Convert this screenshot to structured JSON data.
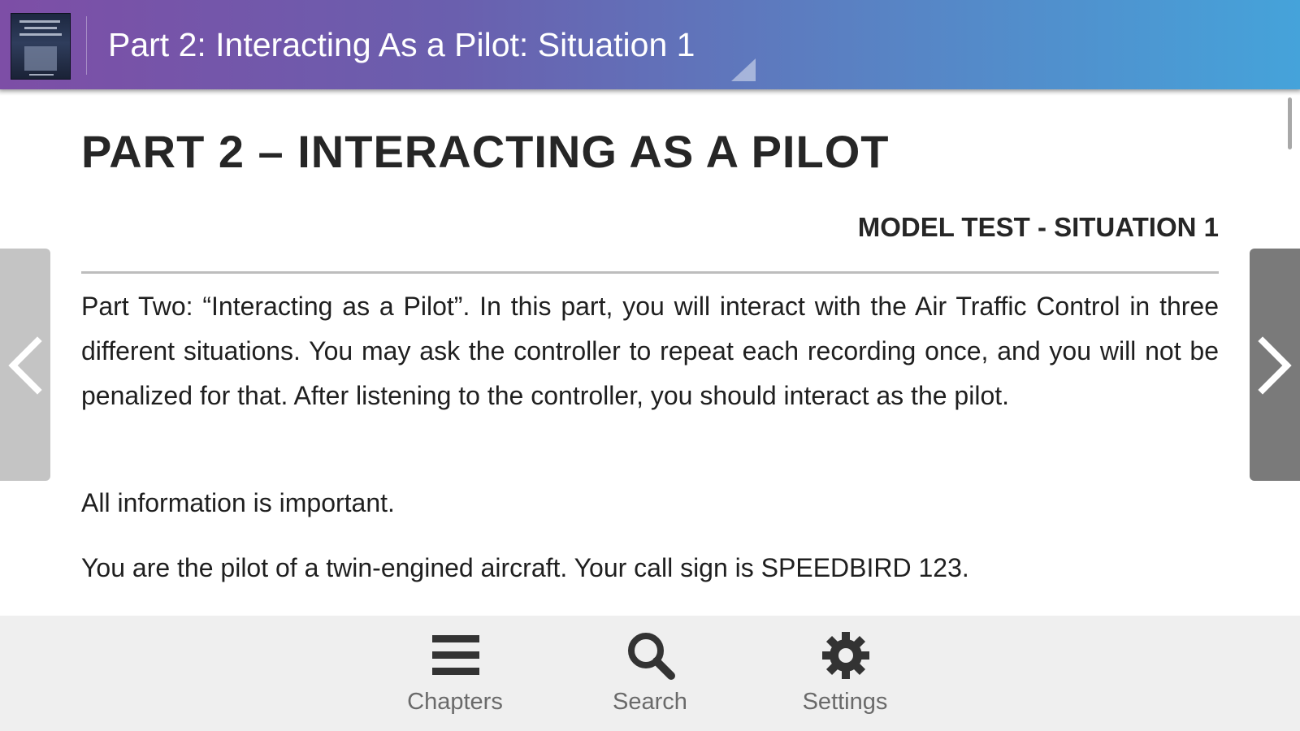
{
  "header": {
    "title": "Part 2: Interacting As a Pilot: Situation 1",
    "book_cover_icon": "book-cover-thumbnail",
    "dropdown_icon": "dropdown-corner-icon",
    "gradient_start": "#7d4ea6",
    "gradient_end": "#45a3da"
  },
  "content": {
    "heading": "PART 2 – INTERACTING AS A PILOT",
    "subheading": "MODEL TEST - SITUATION 1",
    "paragraphs": [
      "Part Two: “Interacting as a Pilot”. In this part, you will interact with the Air Traffic Control in three different situations. You may ask the controller to repeat each recording once, and you will not be penalized for that. After listening to the controller, you should interact as the pilot.",
      "All information is important.",
      "You are the pilot of a twin-engined aircraft. Your call sign is SPEEDBIRD 123."
    ]
  },
  "navigation": {
    "prev_icon": "chevron-left-icon",
    "next_icon": "chevron-right-icon"
  },
  "toolbar": {
    "chapters_label": "Chapters",
    "search_label": "Search",
    "settings_label": "Settings",
    "chapters_icon": "menu-icon",
    "search_icon": "search-icon",
    "settings_icon": "gear-icon",
    "background": "#efefef"
  }
}
